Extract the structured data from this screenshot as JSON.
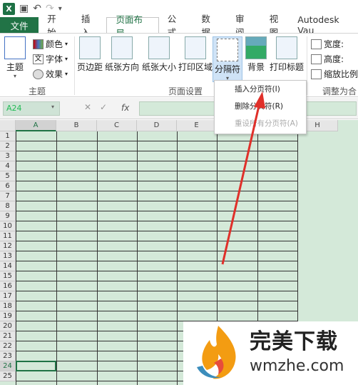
{
  "titlebar": {
    "app_icon_label": "X"
  },
  "tabs": [
    {
      "label": "文件"
    },
    {
      "label": "开始"
    },
    {
      "label": "插入"
    },
    {
      "label": "页面布局"
    },
    {
      "label": "公式"
    },
    {
      "label": "数据"
    },
    {
      "label": "审阅"
    },
    {
      "label": "视图"
    },
    {
      "label": "Autodesk Vau"
    }
  ],
  "ribbon": {
    "theme": "主题",
    "colors": "颜色",
    "fonts": "字体",
    "effects": "效果",
    "margins": "页边距",
    "orientation": "纸张方向",
    "size": "纸张大小",
    "print_area": "打印区域",
    "breaks": "分隔符",
    "background": "背景",
    "print_titles": "打印标题",
    "width": "宽度:",
    "height": "高度:",
    "scale": "缩放比例",
    "group_theme": "主题",
    "group_page_setup": "页面设置",
    "group_fit": "调整为合"
  },
  "menu": {
    "insert_break": "插入分页符(I)",
    "remove_break": "删除分页符(R)",
    "reset_all": "重设所有分页符(A)"
  },
  "formula_bar": {
    "name_box": "A24",
    "fx": "fx"
  },
  "grid": {
    "columns": [
      "A",
      "B",
      "C",
      "D",
      "E",
      "F",
      "G",
      "H"
    ],
    "rows": [
      "1",
      "2",
      "3",
      "4",
      "5",
      "6",
      "7",
      "8",
      "9",
      "10",
      "11",
      "12",
      "13",
      "14",
      "15",
      "16",
      "17",
      "18",
      "19",
      "20",
      "21",
      "22",
      "23",
      "24",
      "25"
    ]
  },
  "watermark": {
    "title": "完美下载",
    "site": "wmzhe.com"
  },
  "colors": {
    "excel_green": "#217346",
    "sheet_tint": "#d4e9d9",
    "arrow_red": "#e0302a"
  }
}
